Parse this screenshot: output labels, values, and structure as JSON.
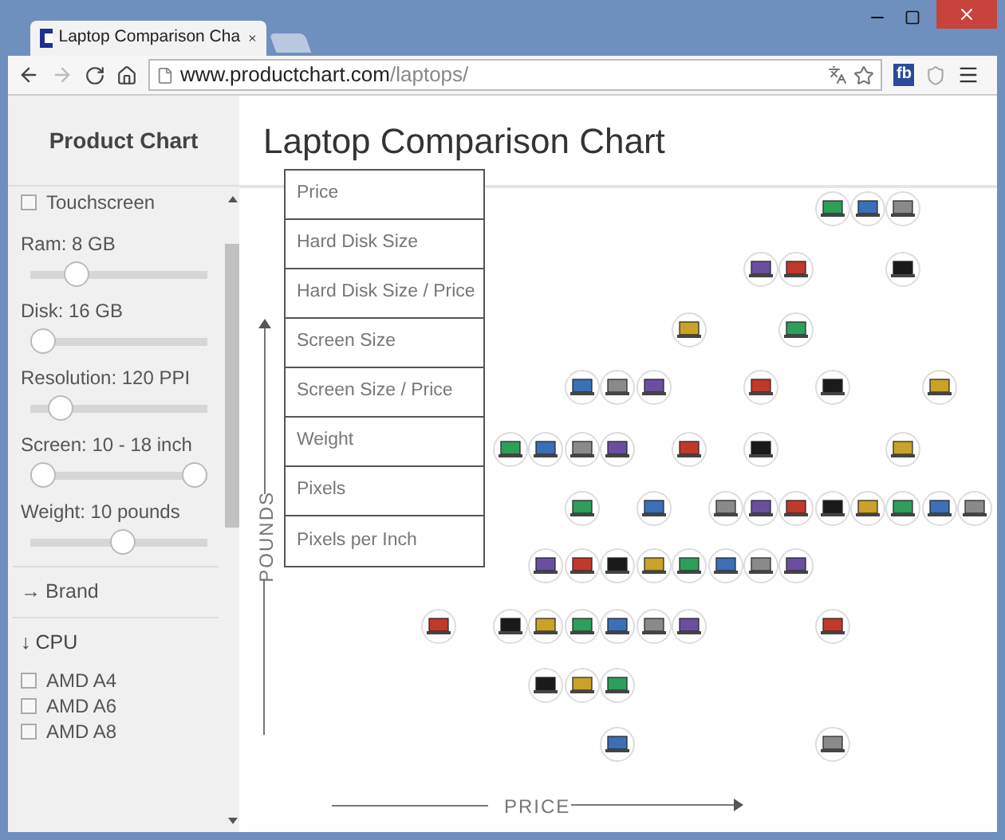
{
  "browser": {
    "tab_title": "Laptop Comparison Cha",
    "url_host": "www.productchart.com",
    "url_path": "/laptops/",
    "extension_label": "fb"
  },
  "sidebar": {
    "title": "Product Chart",
    "filters": [
      {
        "kind": "checkbox",
        "label": "Touchscreen",
        "checked": false
      },
      {
        "kind": "slider",
        "label": "Ram: 8 GB",
        "level": 0.22
      },
      {
        "kind": "slider",
        "label": "Disk: 16 GB",
        "level": 0
      },
      {
        "kind": "slider",
        "label": "Resolution: 120 PPI",
        "level": 0.12
      },
      {
        "kind": "range",
        "label": "Screen: 10 - 18 inch",
        "thumbs": [
          {
            "level": 0
          },
          {
            "level": 1
          }
        ]
      },
      {
        "kind": "slider",
        "label": "Weight: 10 pounds",
        "level": 0.53
      }
    ],
    "sections": [
      {
        "arrow": "→",
        "label": "Brand",
        "expanded": false
      },
      {
        "arrow": "↓",
        "label": "CPU",
        "expanded": true,
        "options": [
          {
            "label": "AMD A4",
            "checked": false
          },
          {
            "label": "AMD A6",
            "checked": false
          },
          {
            "label": "AMD A8",
            "checked": false
          }
        ]
      }
    ]
  },
  "main": {
    "title": "Laptop Comparison Chart",
    "y_axis": "POUNDS",
    "x_axis": "PRICE",
    "axis_menu": [
      "Price",
      "Hard Disk Size",
      "Hard Disk Size / Price",
      "Screen Size",
      "Screen Size / Price",
      "Weight",
      "Pixels",
      "Pixels per Inch"
    ]
  }
}
